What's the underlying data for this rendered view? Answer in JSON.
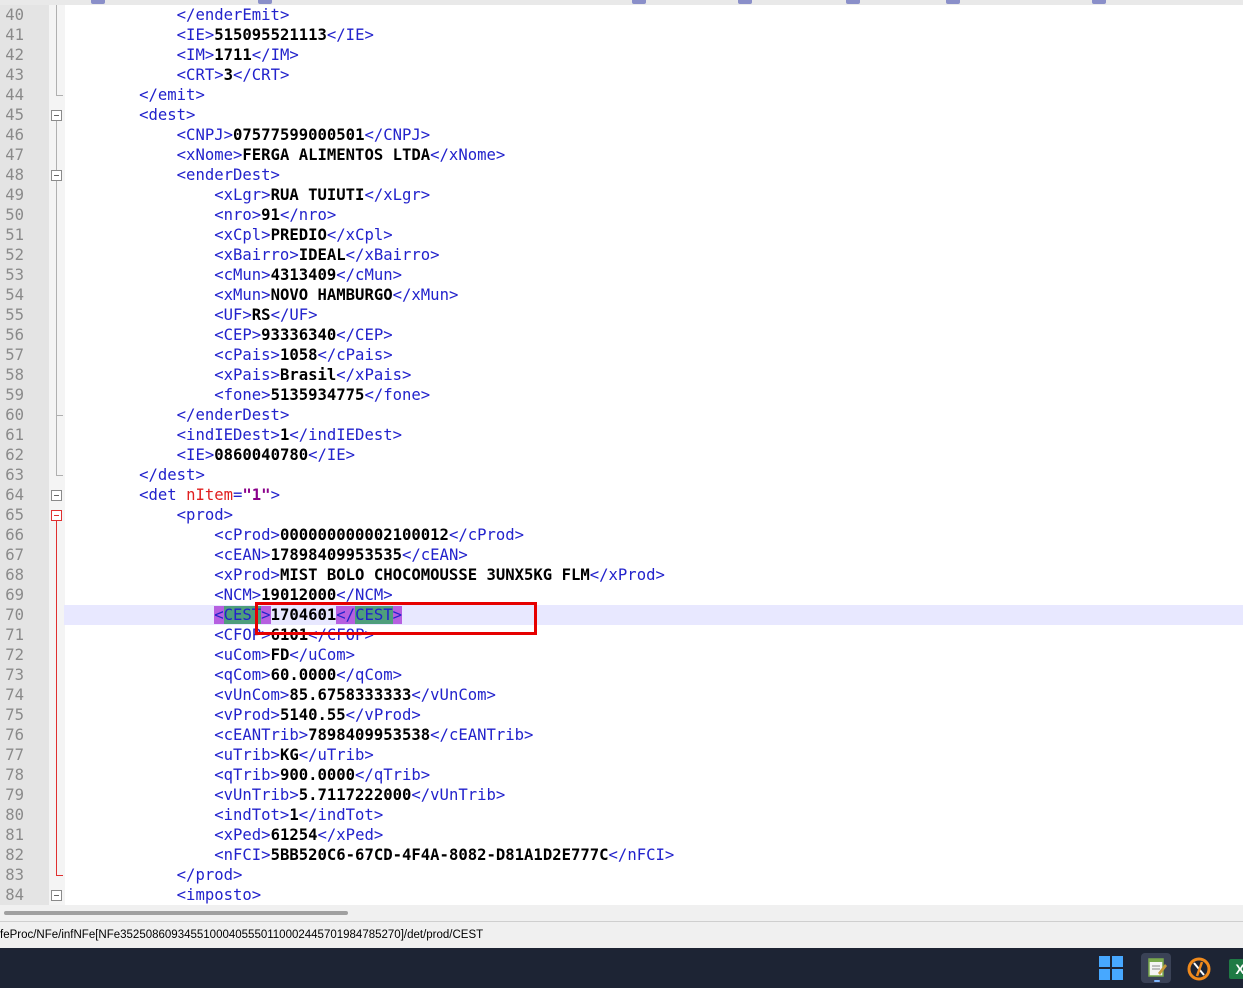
{
  "editor": {
    "current_line": 70,
    "lines": [
      {
        "n": "40",
        "html": "            <span class='tag'>&lt;/enderEmit&gt;</span>"
      },
      {
        "n": "41",
        "html": "            <span class='tag'>&lt;IE&gt;</span><span class='val'>515095521113</span><span class='tag'>&lt;/IE&gt;</span>"
      },
      {
        "n": "42",
        "html": "            <span class='tag'>&lt;IM&gt;</span><span class='val'>1711</span><span class='tag'>&lt;/IM&gt;</span>"
      },
      {
        "n": "43",
        "html": "            <span class='tag'>&lt;CRT&gt;</span><span class='val'>3</span><span class='tag'>&lt;/CRT&gt;</span>"
      },
      {
        "n": "44",
        "html": "        <span class='tag'>&lt;/emit&gt;</span>"
      },
      {
        "n": "45",
        "html": "        <span class='tag'>&lt;dest&gt;</span>"
      },
      {
        "n": "46",
        "html": "            <span class='tag'>&lt;CNPJ&gt;</span><span class='val'>07577599000501</span><span class='tag'>&lt;/CNPJ&gt;</span>"
      },
      {
        "n": "47",
        "html": "            <span class='tag'>&lt;xNome&gt;</span><span class='val'>FERGA ALIMENTOS LTDA</span><span class='tag'>&lt;/xNome&gt;</span>"
      },
      {
        "n": "48",
        "html": "            <span class='tag'>&lt;enderDest&gt;</span>"
      },
      {
        "n": "49",
        "html": "                <span class='tag'>&lt;xLgr&gt;</span><span class='val'>RUA TUIUTI</span><span class='tag'>&lt;/xLgr&gt;</span>"
      },
      {
        "n": "50",
        "html": "                <span class='tag'>&lt;nro&gt;</span><span class='val'>91</span><span class='tag'>&lt;/nro&gt;</span>"
      },
      {
        "n": "51",
        "html": "                <span class='tag'>&lt;xCpl&gt;</span><span class='val'>PREDIO</span><span class='tag'>&lt;/xCpl&gt;</span>"
      },
      {
        "n": "52",
        "html": "                <span class='tag'>&lt;xBairro&gt;</span><span class='val'>IDEAL</span><span class='tag'>&lt;/xBairro&gt;</span>"
      },
      {
        "n": "53",
        "html": "                <span class='tag'>&lt;cMun&gt;</span><span class='val'>4313409</span><span class='tag'>&lt;/cMun&gt;</span>"
      },
      {
        "n": "54",
        "html": "                <span class='tag'>&lt;xMun&gt;</span><span class='val'>NOVO HAMBURGO</span><span class='tag'>&lt;/xMun&gt;</span>"
      },
      {
        "n": "55",
        "html": "                <span class='tag'>&lt;UF&gt;</span><span class='val'>RS</span><span class='tag'>&lt;/UF&gt;</span>"
      },
      {
        "n": "56",
        "html": "                <span class='tag'>&lt;CEP&gt;</span><span class='val'>93336340</span><span class='tag'>&lt;/CEP&gt;</span>"
      },
      {
        "n": "57",
        "html": "                <span class='tag'>&lt;cPais&gt;</span><span class='val'>1058</span><span class='tag'>&lt;/cPais&gt;</span>"
      },
      {
        "n": "58",
        "html": "                <span class='tag'>&lt;xPais&gt;</span><span class='val'>Brasil</span><span class='tag'>&lt;/xPais&gt;</span>"
      },
      {
        "n": "59",
        "html": "                <span class='tag'>&lt;fone&gt;</span><span class='val'>5135934775</span><span class='tag'>&lt;/fone&gt;</span>"
      },
      {
        "n": "60",
        "html": "            <span class='tag'>&lt;/enderDest&gt;</span>"
      },
      {
        "n": "61",
        "html": "            <span class='tag'>&lt;indIEDest&gt;</span><span class='val'>1</span><span class='tag'>&lt;/indIEDest&gt;</span>"
      },
      {
        "n": "62",
        "html": "            <span class='tag'>&lt;IE&gt;</span><span class='val'>0860040780</span><span class='tag'>&lt;/IE&gt;</span>"
      },
      {
        "n": "63",
        "html": "        <span class='tag'>&lt;/dest&gt;</span>"
      },
      {
        "n": "64",
        "html": "        <span class='tag'>&lt;det </span><span class='attr'>nItem</span><span class='tag'>=</span><span class='str'>\"1\"</span><span class='tag'>&gt;</span>"
      },
      {
        "n": "65",
        "html": "            <span class='tag'>&lt;prod&gt;</span>"
      },
      {
        "n": "66",
        "html": "                <span class='tag'>&lt;cProd&gt;</span><span class='val'>000000000002100012</span><span class='tag'>&lt;/cProd&gt;</span>"
      },
      {
        "n": "67",
        "html": "                <span class='tag'>&lt;cEAN&gt;</span><span class='val'>17898409953535</span><span class='tag'>&lt;/cEAN&gt;</span>"
      },
      {
        "n": "68",
        "html": "                <span class='tag'>&lt;xProd&gt;</span><span class='val'>MIST BOLO CHOCOMOUSSE 3UNX5KG FLM</span><span class='tag'>&lt;/xProd&gt;</span>"
      },
      {
        "n": "69",
        "html": "                <span class='tag'>&lt;NCM&gt;</span><span class='val'>19012000</span><span class='tag'>&lt;/NCM&gt;</span>"
      },
      {
        "n": "70",
        "html": "                <span class='tag hl-a'>&lt;</span><span class='tag hl-b'>CEST</span><span class='tag hl-a'>&gt;</span><span class='val'>1704601</span><span class='tag hl-a'>&lt;/</span><span class='tag hl-b'>CEST</span><span class='tag hl-a'>&gt;</span>"
      },
      {
        "n": "71",
        "html": "                <span class='tag'>&lt;CFOP&gt;</span><span class='val'>6101</span><span class='tag'>&lt;/CFOP&gt;</span>"
      },
      {
        "n": "72",
        "html": "                <span class='tag'>&lt;uCom&gt;</span><span class='val'>FD</span><span class='tag'>&lt;/uCom&gt;</span>"
      },
      {
        "n": "73",
        "html": "                <span class='tag'>&lt;qCom&gt;</span><span class='val'>60.0000</span><span class='tag'>&lt;/qCom&gt;</span>"
      },
      {
        "n": "74",
        "html": "                <span class='tag'>&lt;vUnCom&gt;</span><span class='val'>85.6758333333</span><span class='tag'>&lt;/vUnCom&gt;</span>"
      },
      {
        "n": "75",
        "html": "                <span class='tag'>&lt;vProd&gt;</span><span class='val'>5140.55</span><span class='tag'>&lt;/vProd&gt;</span>"
      },
      {
        "n": "76",
        "html": "                <span class='tag'>&lt;cEANTrib&gt;</span><span class='val'>7898409953538</span><span class='tag'>&lt;/cEANTrib&gt;</span>"
      },
      {
        "n": "77",
        "html": "                <span class='tag'>&lt;uTrib&gt;</span><span class='val'>KG</span><span class='tag'>&lt;/uTrib&gt;</span>"
      },
      {
        "n": "78",
        "html": "                <span class='tag'>&lt;qTrib&gt;</span><span class='val'>900.0000</span><span class='tag'>&lt;/qTrib&gt;</span>"
      },
      {
        "n": "79",
        "html": "                <span class='tag'>&lt;vUnTrib&gt;</span><span class='val'>5.7117222000</span><span class='tag'>&lt;/vUnTrib&gt;</span>"
      },
      {
        "n": "80",
        "html": "                <span class='tag'>&lt;indTot&gt;</span><span class='val'>1</span><span class='tag'>&lt;/indTot&gt;</span>"
      },
      {
        "n": "81",
        "html": "                <span class='tag'>&lt;xPed&gt;</span><span class='val'>61254</span><span class='tag'>&lt;/xPed&gt;</span>"
      },
      {
        "n": "82",
        "html": "                <span class='tag'>&lt;nFCI&gt;</span><span class='val'>5BB520C6-67CD-4F4A-8082-D81A1D2E777C</span><span class='tag'>&lt;/nFCI&gt;</span>"
      },
      {
        "n": "83",
        "html": "            <span class='tag'>&lt;/prod&gt;</span>"
      },
      {
        "n": "84",
        "html": "            <span class='tag'>&lt;imposto&gt;</span>"
      }
    ]
  },
  "status_bar": {
    "xpath": "feProc/NFe/infNFe[NFe35250860934551000405550110002445701984785270]/det/prod/CEST"
  },
  "taskbar": {
    "icons": [
      "windows-start-icon",
      "notepad-plus-plus-icon",
      "orange-app-icon",
      "excel-icon"
    ],
    "excel_letter": "X"
  },
  "colors": {
    "tag": "#2222cc",
    "value": "#000000",
    "attribute": "#e02020",
    "string": "#8a008a",
    "highlight_bracket": "#b65fe0",
    "highlight_name": "#4e9e7c",
    "annotation_box": "#e60000",
    "taskbar": "#1d2434"
  }
}
